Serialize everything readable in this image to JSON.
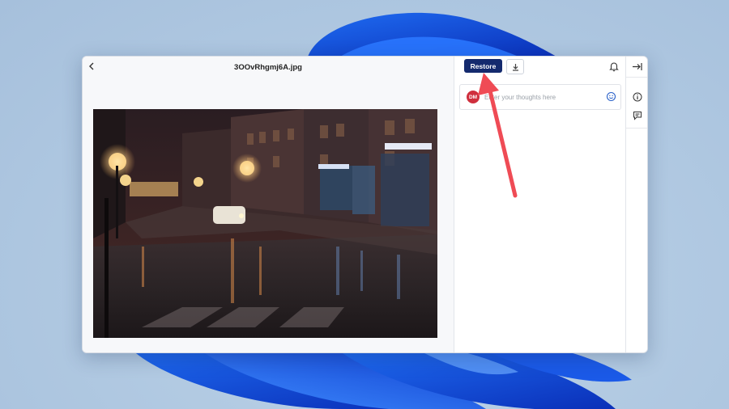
{
  "viewer": {
    "file_name": "3OOvRhgmj6A.jpg",
    "back_icon": "chevron-left-icon",
    "image_subject": "rainy night city street photo"
  },
  "toolbar": {
    "restore_label": "Restore",
    "download_icon": "download-icon",
    "notifications_icon": "bell-icon"
  },
  "comment": {
    "avatar_initials": "DM",
    "placeholder": "Enter your thoughts here",
    "emoji_icon": "emoji-icon"
  },
  "rail": {
    "collapse_icon": "collapse-panel-icon",
    "info_icon": "info-icon",
    "comments_icon": "comments-icon"
  },
  "colors": {
    "accent": "#142a6e",
    "avatar": "#cf2f3d",
    "annotation_arrow": "#ef4b55"
  }
}
